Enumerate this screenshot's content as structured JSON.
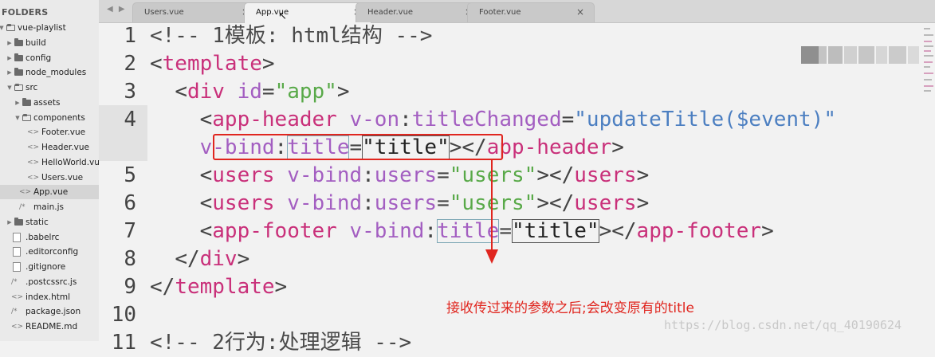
{
  "sidebar": {
    "header": "FOLDERS",
    "items": [
      {
        "label": "vue-playlist",
        "type": "folder",
        "expanded": true,
        "depth": 0
      },
      {
        "label": "build",
        "type": "folder",
        "expanded": false,
        "depth": 1
      },
      {
        "label": "config",
        "type": "folder",
        "expanded": false,
        "depth": 1
      },
      {
        "label": "node_modules",
        "type": "folder",
        "expanded": false,
        "depth": 1
      },
      {
        "label": "src",
        "type": "folder",
        "expanded": true,
        "depth": 1
      },
      {
        "label": "assets",
        "type": "folder",
        "expanded": false,
        "depth": 2
      },
      {
        "label": "components",
        "type": "folder",
        "expanded": true,
        "depth": 2
      },
      {
        "label": "Footer.vue",
        "type": "vue",
        "depth": 3
      },
      {
        "label": "Header.vue",
        "type": "vue",
        "depth": 3
      },
      {
        "label": "HelloWorld.vue",
        "type": "vue",
        "depth": 3
      },
      {
        "label": "Users.vue",
        "type": "vue",
        "depth": 3
      },
      {
        "label": "App.vue",
        "type": "vue",
        "depth": 2,
        "selected": true
      },
      {
        "label": "main.js",
        "type": "js",
        "depth": 2
      },
      {
        "label": "static",
        "type": "folder",
        "expanded": false,
        "depth": 1
      },
      {
        "label": ".babelrc",
        "type": "file",
        "depth": 1
      },
      {
        "label": ".editorconfig",
        "type": "file",
        "depth": 1
      },
      {
        "label": ".gitignore",
        "type": "file",
        "depth": 1
      },
      {
        "label": ".postcssrc.js",
        "type": "js",
        "depth": 1
      },
      {
        "label": "index.html",
        "type": "vue",
        "depth": 1
      },
      {
        "label": "package.json",
        "type": "js",
        "depth": 1
      },
      {
        "label": "README.md",
        "type": "vue",
        "depth": 1
      }
    ]
  },
  "tabs": {
    "nav_glyph": "◀ ▶",
    "close_glyph": "×",
    "items": [
      {
        "label": "Users.vue",
        "active": false
      },
      {
        "label": "App.vue",
        "active": true
      },
      {
        "label": "Header.vue",
        "active": false
      },
      {
        "label": "Footer.vue",
        "active": false
      }
    ]
  },
  "editor": {
    "lines": [
      {
        "num": "1",
        "tokens": [
          [
            "c",
            "<!-- 1模板: html结构 -->"
          ]
        ]
      },
      {
        "num": "2",
        "tokens": [
          [
            "b",
            "<"
          ],
          [
            "t",
            "template"
          ],
          [
            "b",
            ">"
          ]
        ]
      },
      {
        "num": "3",
        "tokens": [
          [
            "p",
            "  "
          ],
          [
            "b",
            "<"
          ],
          [
            "t",
            "div"
          ],
          [
            "p",
            " "
          ],
          [
            "a",
            "id"
          ],
          [
            "o",
            "="
          ],
          [
            "s",
            "\"app\""
          ],
          [
            "b",
            ">"
          ]
        ]
      },
      {
        "num": "4",
        "tokens": [
          [
            "p",
            "    "
          ],
          [
            "b",
            "<"
          ],
          [
            "t",
            "app-header"
          ],
          [
            "p",
            " "
          ],
          [
            "a",
            "v-on"
          ],
          [
            "o",
            ":"
          ],
          [
            "a",
            "titleChanged"
          ],
          [
            "o",
            "="
          ],
          [
            "s2",
            "\"updateTitle($event)\""
          ]
        ]
      },
      {
        "num": "",
        "tokens": [
          [
            "p",
            "    "
          ],
          [
            "a",
            "v-bind"
          ],
          [
            "o",
            ":"
          ],
          [
            "ab",
            "title"
          ],
          [
            "o",
            "="
          ],
          [
            "sb",
            "\"title\""
          ],
          [
            "b",
            "></"
          ],
          [
            "t",
            "app-header"
          ],
          [
            "b",
            ">"
          ]
        ]
      },
      {
        "num": "5",
        "tokens": [
          [
            "p",
            "    "
          ],
          [
            "b",
            "<"
          ],
          [
            "t",
            "users"
          ],
          [
            "p",
            " "
          ],
          [
            "a",
            "v-bind"
          ],
          [
            "o",
            ":"
          ],
          [
            "a",
            "users"
          ],
          [
            "o",
            "="
          ],
          [
            "s",
            "\"users\""
          ],
          [
            "b",
            "></"
          ],
          [
            "t",
            "users"
          ],
          [
            "b",
            ">"
          ]
        ]
      },
      {
        "num": "6",
        "tokens": [
          [
            "p",
            "    "
          ],
          [
            "b",
            "<"
          ],
          [
            "t",
            "users"
          ],
          [
            "p",
            " "
          ],
          [
            "a",
            "v-bind"
          ],
          [
            "o",
            ":"
          ],
          [
            "a",
            "users"
          ],
          [
            "o",
            "="
          ],
          [
            "s",
            "\"users\""
          ],
          [
            "b",
            "></"
          ],
          [
            "t",
            "users"
          ],
          [
            "b",
            ">"
          ]
        ]
      },
      {
        "num": "7",
        "tokens": [
          [
            "p",
            "    "
          ],
          [
            "b",
            "<"
          ],
          [
            "t",
            "app-footer"
          ],
          [
            "p",
            " "
          ],
          [
            "a",
            "v-bind"
          ],
          [
            "o",
            ":"
          ],
          [
            "ab",
            "title"
          ],
          [
            "o",
            "="
          ],
          [
            "sb",
            "\"title\""
          ],
          [
            "b",
            "></"
          ],
          [
            "t",
            "app-footer"
          ],
          [
            "b",
            ">"
          ]
        ]
      },
      {
        "num": "8",
        "tokens": [
          [
            "p",
            "  "
          ],
          [
            "b",
            "</"
          ],
          [
            "t",
            "div"
          ],
          [
            "b",
            ">"
          ]
        ]
      },
      {
        "num": "9",
        "tokens": [
          [
            "b",
            "</"
          ],
          [
            "t",
            "template"
          ],
          [
            "b",
            ">"
          ]
        ]
      },
      {
        "num": "10",
        "tokens": []
      },
      {
        "num": "11",
        "tokens": [
          [
            "c",
            "<!-- 2行为:处理逻辑 -->"
          ]
        ]
      }
    ]
  },
  "annotation": {
    "text": "接收传过来的参数之后;会改变原有的title",
    "color": "#e0261f"
  },
  "watermark": "https://blog.csdn.net/qq_40190624",
  "colors": {
    "tag": "#c9307a",
    "attribute": "#a35ec1",
    "string": "#58a948",
    "string_alt": "#4c7fc1",
    "highlight_box": "#e0261f"
  }
}
